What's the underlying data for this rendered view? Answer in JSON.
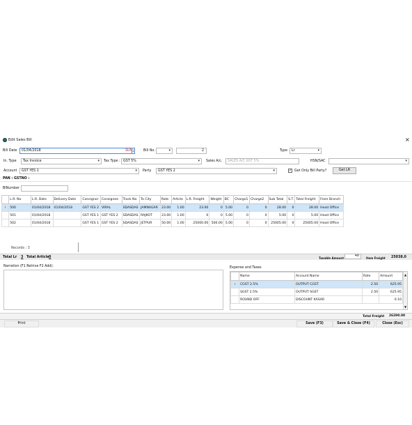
{
  "window": {
    "title": "Edit Sales Bill",
    "close": "×"
  },
  "form": {
    "bill_date_label": "Bill Date",
    "bill_date_value": "01/04/2018",
    "bill_date_day": "SUN",
    "bill_date_cal": "15",
    "bill_no_label": "Bill No.",
    "bill_no_number": "2",
    "type_label": "Type",
    "type_value": "Lr",
    "inv_type_label": "In. Type",
    "inv_type_value": "Tax Invoice",
    "tax_type_label": "Tax Type :",
    "tax_type_value": "GST 5%",
    "sales_ac_label": "Sales A/c.",
    "sales_ac_value": "SALES A/C GST 5%",
    "hsn_label": "HSN/SAC",
    "account_label": "Account",
    "account_value": "GST YES 1",
    "party_label": "Party",
    "party_value": "GST YES 2",
    "get_only_label": "Get Only Bill Party?",
    "get_lr_label": "Get LR",
    "pan_label": "PAN :",
    "gstno_label": "GSTNO :",
    "blnumber_label": "BlNumber"
  },
  "lr_table": {
    "columns": [
      "L.R. No",
      "L.R. Date",
      "Delivery Date",
      "Consignor",
      "Consignee",
      "Truck No",
      "To City",
      "Rate",
      "Article",
      "L.R. Freight",
      "Weight",
      "BC",
      "Charge1",
      "Charge2",
      "Sub Total",
      "S.T.",
      "Total Freight",
      "From Branch"
    ],
    "rows": [
      {
        "marker": "›",
        "cells": [
          "500",
          "01/04/2018",
          "01/04/2018",
          "GST YES 2",
          "VIRAL",
          "SDASDAS",
          "JAMNAGAR",
          "23.00",
          "1.00",
          "23.00",
          "0",
          "5.00",
          "0",
          "0",
          "28.00",
          "0",
          "28.00",
          "Head Office"
        ]
      },
      {
        "marker": "",
        "cells": [
          "501",
          "01/04/2018",
          "",
          "GST YES 1",
          "GST YES 2",
          "SDASDAS",
          "RAJKOT",
          "23.00",
          "1.00",
          "0",
          "0",
          "5.00",
          "0",
          "0",
          "5.00",
          "0",
          "5.00",
          "Head Office"
        ]
      },
      {
        "marker": "",
        "cells": [
          "502",
          "01/04/2018",
          "",
          "GST YES 1",
          "GST YES 2",
          "SDASDAS",
          "JETPUR",
          "50.00",
          "1.00",
          "25000.00",
          "500.00",
          "5.00",
          "0",
          "0",
          "25005.00",
          "0",
          "25005.00",
          "Head Office"
        ]
      }
    ],
    "records_label": "Records : 3"
  },
  "totals": {
    "total_lr_label": "Total Lr",
    "total_lr_value": "3",
    "total_article_label": "Total Article",
    "total_article_value": "0",
    "taxable_amount_label": "Taxable Amount",
    "taxable_amount_value": "48",
    "item_freight_label": "Item Freight",
    "item_freight_value": "25038.0"
  },
  "narration_label": "Narration (F1 Retrive F2 Add):",
  "expense": {
    "title": "Expense and Taxes",
    "columns": [
      "Name",
      "Account Name",
      "Rate",
      "Amount"
    ],
    "rows": [
      {
        "marker": "›",
        "cells": [
          "CGST 2.5%",
          "OUTPUT CGST",
          "2.50",
          "625.95"
        ]
      },
      {
        "marker": "",
        "cells": [
          "SGST 2.5%",
          "OUTPUT SGST",
          "2.50",
          "625.95"
        ]
      },
      {
        "marker": "",
        "cells": [
          "ROUND OFF",
          "DISCOUNT KASAR",
          "",
          "0.10"
        ]
      }
    ]
  },
  "total_freight_label": "Total Freight",
  "total_freight_value": "26290.00",
  "buttons": {
    "print": "Print",
    "save": "Save (F3)",
    "save_close": "Save & Close (F4)",
    "close": "Close (Esc)"
  },
  "colors": {
    "selection": "#cfe5f8",
    "input_focus": "#4b8bd6",
    "weekday_red": "#d21f1f"
  }
}
